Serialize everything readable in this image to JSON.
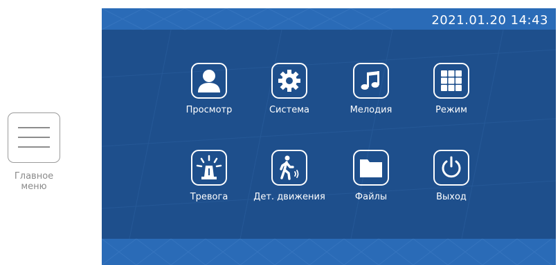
{
  "hint": {
    "label_line1": "Главное",
    "label_line2": "меню"
  },
  "screen": {
    "datetime": "2021.01.20  14:43",
    "colors": {
      "background": "#1e4f8c",
      "band": "#2a6bb7",
      "foreground": "#ffffff"
    }
  },
  "menu": {
    "items": [
      {
        "label": "Просмотр",
        "icon": "user-icon"
      },
      {
        "label": "Система",
        "icon": "gear-icon"
      },
      {
        "label": "Мелодия",
        "icon": "music-note-icon"
      },
      {
        "label": "Режим",
        "icon": "grid-icon"
      },
      {
        "label": "Тревога",
        "icon": "alarm-icon"
      },
      {
        "label": "Дет. движения",
        "icon": "motion-icon"
      },
      {
        "label": "Файлы",
        "icon": "folder-icon"
      },
      {
        "label": "Выход",
        "icon": "power-icon"
      }
    ]
  }
}
